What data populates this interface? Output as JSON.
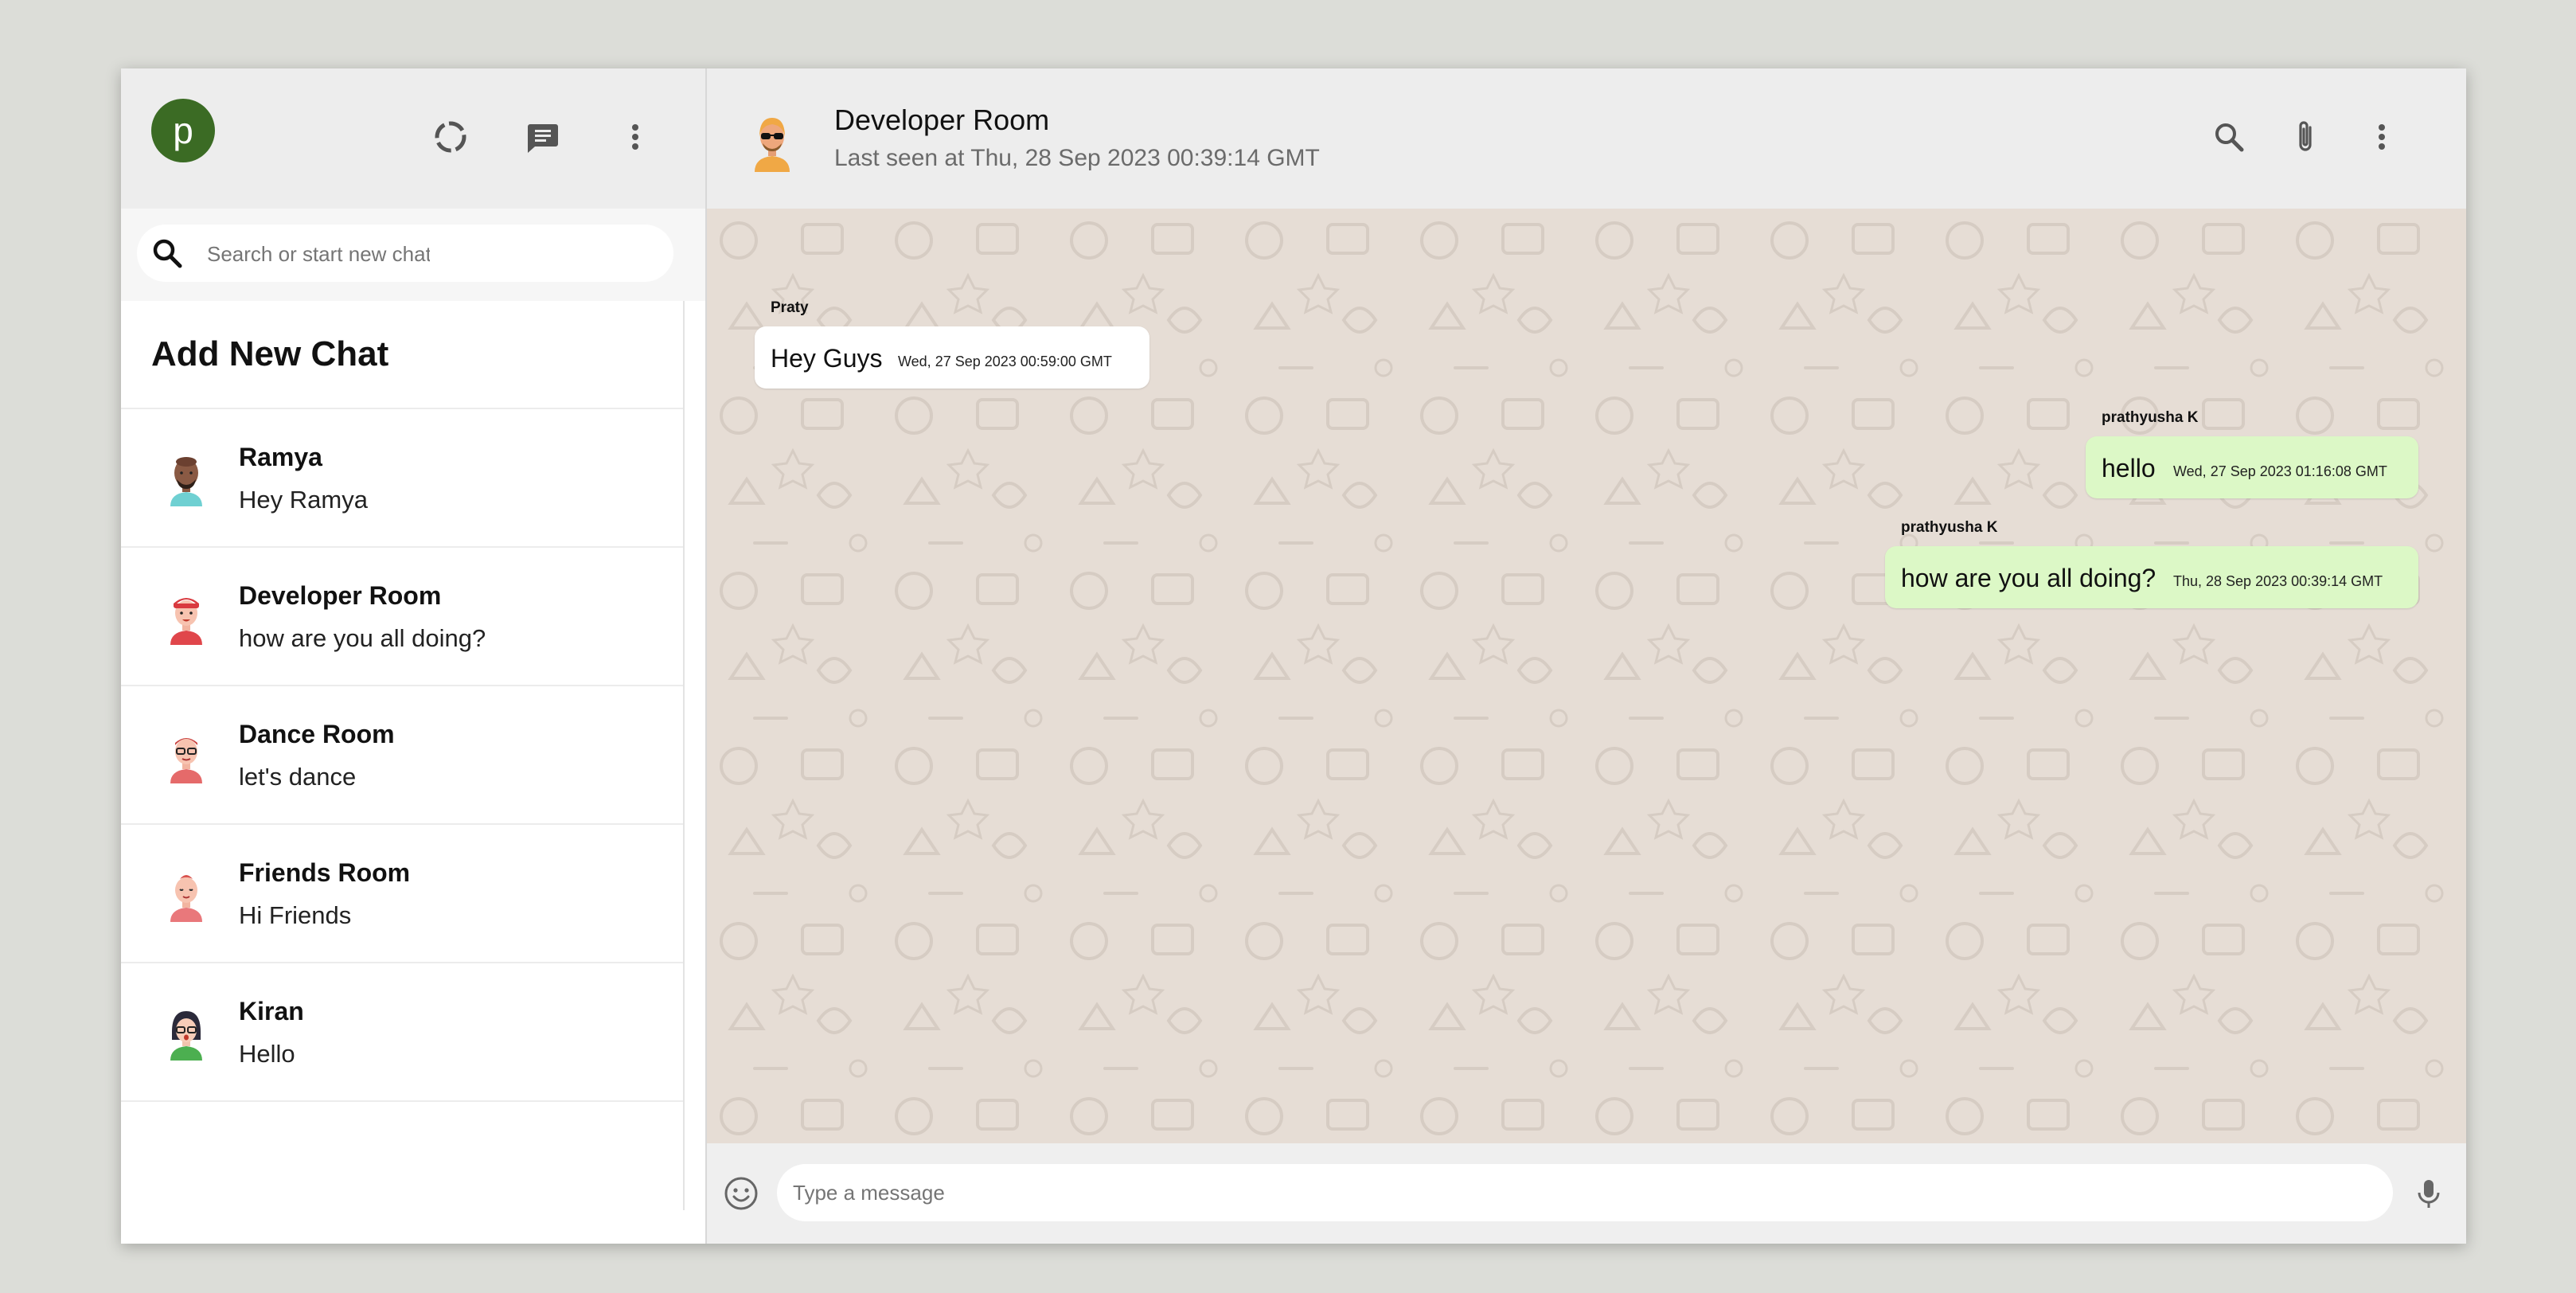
{
  "sidebar": {
    "user_initial": "p",
    "icons": [
      "status-icon",
      "new-chat-icon",
      "menu-icon"
    ],
    "search": {
      "placeholder": "Search or start new chat"
    },
    "add_new_chat": "Add New Chat",
    "chats": [
      {
        "name": "Ramya",
        "last": "Hey Ramya"
      },
      {
        "name": "Developer Room",
        "last": "how are you all doing?"
      },
      {
        "name": "Dance Room",
        "last": "let's dance"
      },
      {
        "name": "Friends Room",
        "last": "Hi Friends"
      },
      {
        "name": "Kiran",
        "last": "Hello"
      }
    ]
  },
  "chat": {
    "title": "Developer Room",
    "subtitle": "Last seen at Thu, 28 Sep 2023 00:39:14 GMT",
    "header_icons": [
      "search-icon",
      "attach-icon",
      "menu-icon"
    ],
    "messages": [
      {
        "sender": "Praty",
        "text": "Hey Guys",
        "time": "Wed, 27 Sep 2023 00:59:00 GMT",
        "mine": false
      },
      {
        "sender": "prathyusha K",
        "text": "hello",
        "time": "Wed, 27 Sep 2023 01:16:08 GMT",
        "mine": true
      },
      {
        "sender": "prathyusha K",
        "text": "how are you all doing?",
        "time": "Thu, 28 Sep 2023 00:39:14 GMT",
        "mine": true
      }
    ],
    "input_placeholder": "Type a message"
  },
  "colors": {
    "user_avatar": "#3b6b24",
    "incoming_bubble": "#ffffff",
    "outgoing_bubble": "#dcf8c6",
    "chat_background": "#e6ddd5"
  }
}
